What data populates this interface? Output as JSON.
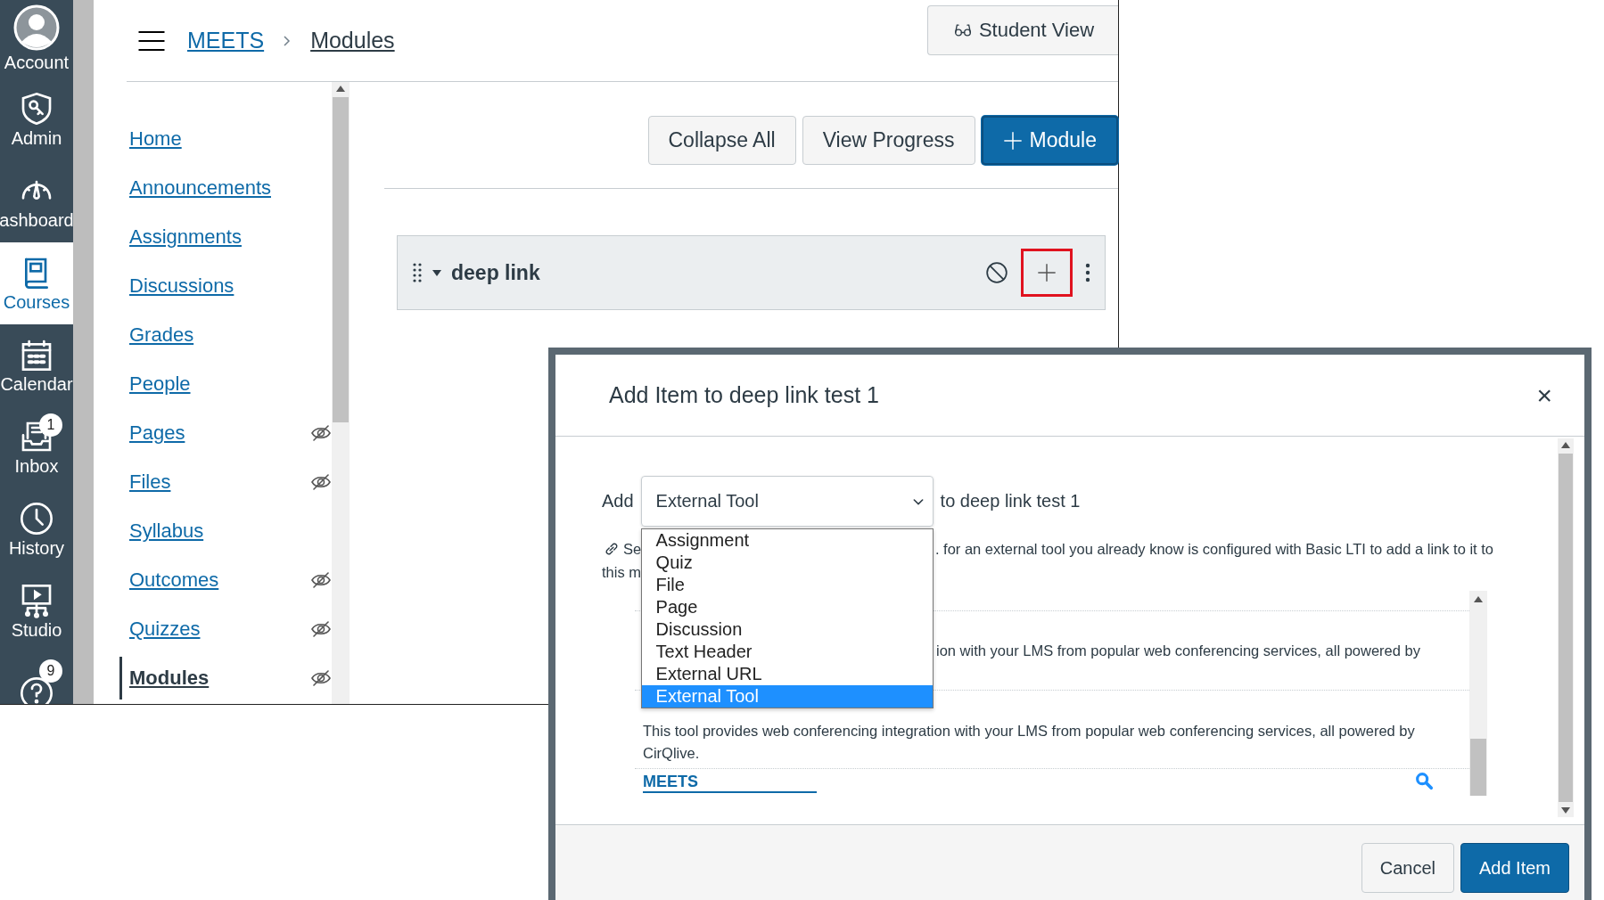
{
  "global_nav": [
    {
      "kind": "account",
      "label": "Account",
      "selected": false
    },
    {
      "kind": "admin",
      "label": "Admin",
      "selected": false
    },
    {
      "kind": "dashboard",
      "label": "ashboard",
      "selected": false
    },
    {
      "kind": "courses",
      "label": "Courses",
      "selected": true
    },
    {
      "kind": "calendar",
      "label": "Calendar",
      "selected": false
    },
    {
      "kind": "inbox",
      "label": "Inbox",
      "selected": false,
      "badge": "1"
    },
    {
      "kind": "history",
      "label": "History",
      "selected": false
    },
    {
      "kind": "studio",
      "label": "Studio",
      "selected": false
    },
    {
      "kind": "help",
      "selected": false,
      "badge": "9"
    }
  ],
  "breadcrumbs": [
    {
      "label": "MEETS",
      "current": false
    },
    {
      "label": "Modules",
      "current": true
    }
  ],
  "student_view_button": "Student View",
  "course_nav": [
    {
      "label": "Home",
      "selected": false,
      "hidden": false
    },
    {
      "label": "Announcements",
      "selected": false,
      "hidden": false
    },
    {
      "label": "Assignments",
      "selected": false,
      "hidden": false
    },
    {
      "label": "Discussions",
      "selected": false,
      "hidden": false
    },
    {
      "label": "Grades",
      "selected": false,
      "hidden": false
    },
    {
      "label": "People",
      "selected": false,
      "hidden": false
    },
    {
      "label": "Pages",
      "selected": false,
      "hidden": true
    },
    {
      "label": "Files",
      "selected": false,
      "hidden": true
    },
    {
      "label": "Syllabus",
      "selected": false,
      "hidden": false
    },
    {
      "label": "Outcomes",
      "selected": false,
      "hidden": true
    },
    {
      "label": "Quizzes",
      "selected": false,
      "hidden": true
    },
    {
      "label": "Modules",
      "selected": true,
      "hidden": true
    }
  ],
  "toolbar_buttons": [
    {
      "label": "Collapse All",
      "kind": "plain"
    },
    {
      "label": "View Progress",
      "kind": "plain"
    },
    {
      "label": "Module",
      "kind": "add"
    }
  ],
  "module": {
    "title": "deep link",
    "add_highlighted": true
  },
  "dialog": {
    "title": "Add Item to deep link test 1",
    "close": "×",
    "add_label": "Add",
    "select": {
      "value": "External Tool",
      "options": [
        {
          "label": "Assignment",
          "selected": false
        },
        {
          "label": "Quiz",
          "selected": false
        },
        {
          "label": "File",
          "selected": false
        },
        {
          "label": "Page",
          "selected": false
        },
        {
          "label": "Discussion",
          "selected": false
        },
        {
          "label": "Text Header",
          "selected": false
        },
        {
          "label": "External URL",
          "selected": false
        },
        {
          "label": "External Tool",
          "selected": true
        }
      ]
    },
    "suffix": "to deep link test 1",
    "description": {
      "start": "Se",
      "rest": ". for an external tool you already know is configured with Basic LTI to add a link to it to",
      "second_line": "this m"
    },
    "tools": [
      {
        "description": "ion with your LMS from popular web conferencing services, all powered by"
      },
      {
        "description": "This tool provides web conferencing integration with your LMS from popular web conferencing services, all powered by CirQlive."
      }
    ],
    "tool_link": "MEETS",
    "buttons": [
      {
        "label": "Cancel",
        "kind": "secondary"
      },
      {
        "label": "Add Item",
        "kind": "primary"
      }
    ]
  }
}
